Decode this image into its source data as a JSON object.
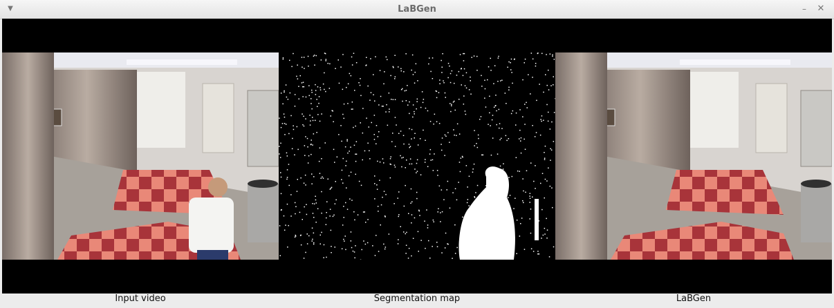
{
  "window": {
    "title": "LaBGen"
  },
  "panels": {
    "input": {
      "caption": "Input video"
    },
    "segmentation": {
      "caption": "Segmentation map"
    },
    "background": {
      "caption": "LaBGen"
    }
  },
  "icons": {
    "menu": "chevron-down-icon",
    "minimize": "minimize-icon",
    "close": "close-icon"
  }
}
